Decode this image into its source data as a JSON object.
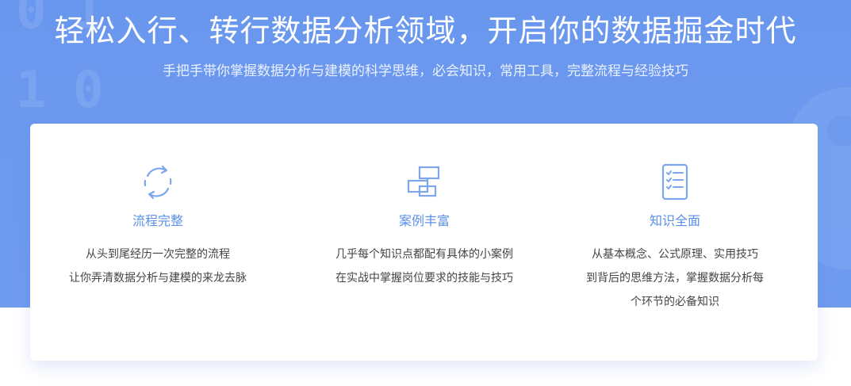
{
  "colors": {
    "banner_bg": "#6a97ee",
    "accent": "#5b8fe8",
    "card_bg": "#ffffff",
    "body_text": "#444444"
  },
  "banner": {
    "deco_digits": [
      "0",
      "1",
      "1",
      "0"
    ],
    "title": "轻松入行、转行数据分析领域，开启你的数据掘金时代",
    "subtitle": "手把手带你掌握数据分析与建模的科学思维，必会知识，常用工具，完整流程与经验技巧"
  },
  "features": [
    {
      "icon": "refresh-cycle-icon",
      "title": "流程完整",
      "desc": [
        "从头到尾经历一次完整的流程",
        "让你弄清数据分析与建模的来龙去脉"
      ]
    },
    {
      "icon": "stacked-boxes-icon",
      "title": "案例丰富",
      "desc": [
        "几乎每个知识点都配有具体的小案例",
        "在实战中掌握岗位要求的技能与技巧"
      ]
    },
    {
      "icon": "checklist-icon",
      "title": "知识全面",
      "desc": [
        "从基本概念、公式原理、实用技巧",
        "到背后的思维方法，掌握数据分析每",
        "个环节的必备知识"
      ]
    }
  ]
}
